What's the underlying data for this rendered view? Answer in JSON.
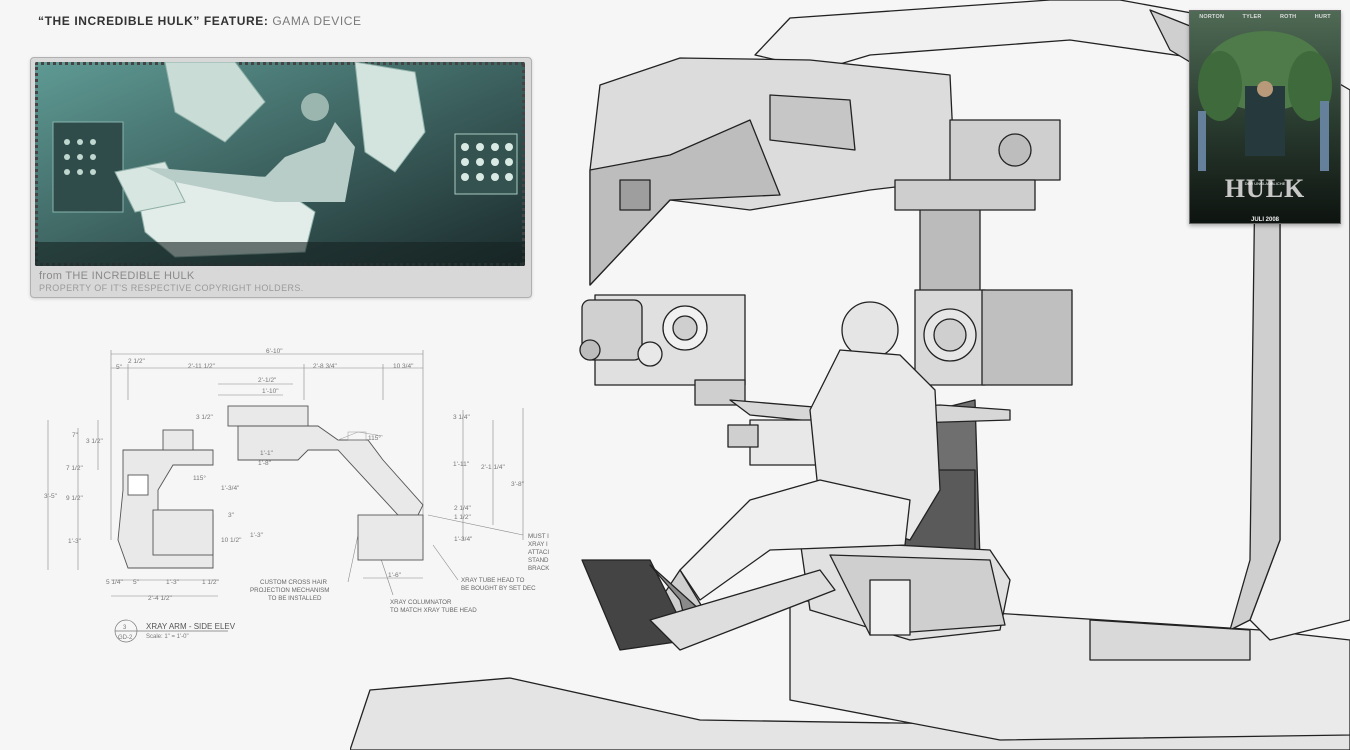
{
  "header": {
    "title_bold": "“THE INCREDIBLE HULK” FEATURE:",
    "title_rest": "GAMA DEVICE"
  },
  "still": {
    "caption_line1": "from THE INCREDIBLE HULK",
    "caption_line2": "PROPERTY OF IT'S RESPECTIVE COPYRIGHT HOLDERS."
  },
  "drawing": {
    "title": "XRAY ARM - SIDE ELEV",
    "number": "3",
    "sheet": "GD-2",
    "scale": "Scale: 1\" = 1'-0\"",
    "dims": [
      "6'-10\"",
      "2'-11 1/2\"",
      "2'-8 3/4\"",
      "10 3/4\"",
      "2 1/2\"",
      "5\"",
      "2'-1/2\"",
      "1'-10\"",
      "3 1/2\"",
      "3 1/4\"",
      "7\"",
      "3 1/2\"",
      "7 1/2\"",
      "9 1/2\"",
      "3'-5\"",
      "1'-3\"",
      "1'-1\"",
      "1'-8\"",
      "115°",
      "115°",
      "1'-3/4\"",
      "1'-11\"",
      "2'-1 1/4\"",
      "3'-8\"",
      "2 1/4\"",
      "1 1/2\"",
      "1'-3/4\"",
      "10 1/2\"",
      "1'-3\"",
      "3\"",
      "1'-6\"",
      "5 1/4\"",
      "5\"",
      "1'-3\"",
      "1 1/2\"",
      "2'-4 1/2\""
    ],
    "notes": {
      "crosshair": [
        "CUSTOM CROSS HAIR",
        "PROJECTION MECHANISM",
        "TO BE INSTALLED"
      ],
      "collimator": [
        "XRAY COLUMNATOR",
        "TO MATCH XRAY TUBE HEAD"
      ],
      "tubehead": [
        "XRAY TUBE HEAD TO",
        "BE BOUGHT BY SET DEC"
      ],
      "must": [
        "MUST I",
        "XRAY I",
        "ATTACI",
        "STAND",
        "BRACK"
      ]
    }
  },
  "poster": {
    "names": [
      "NORTON",
      "TYLER",
      "ROTH",
      "HURT"
    ],
    "title": "HULK",
    "subtitle": "DER UNGLAUBLICHE",
    "date": "JULI 2008"
  },
  "colors": {
    "background": "#f6f6f6",
    "still_tint": "#6fb0a8",
    "poster_green": "#2f4a2a"
  }
}
